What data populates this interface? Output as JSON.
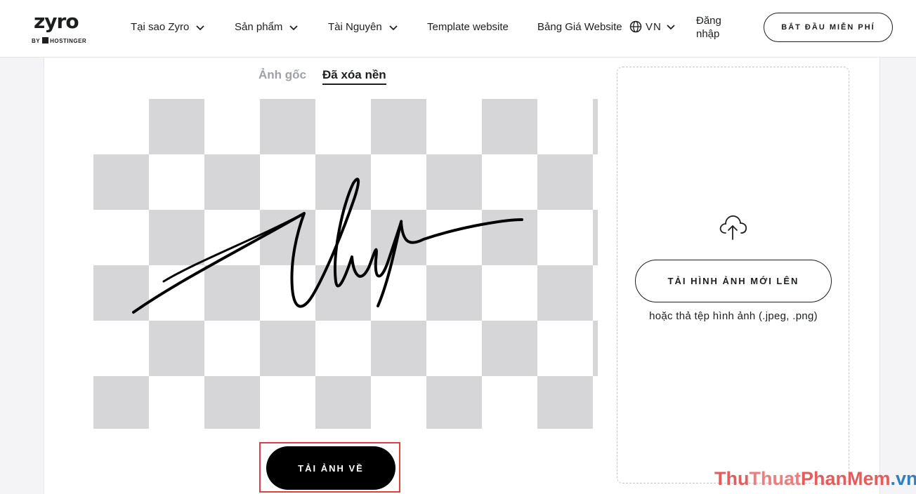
{
  "header": {
    "logo_word": "zyro",
    "logo_by": "BY",
    "logo_brand": "HOSTINGER",
    "nav": [
      {
        "label": "Tại sao Zyro"
      },
      {
        "label": "Sản phẩm"
      },
      {
        "label": "Tài Nguyên"
      },
      {
        "label": "Template website"
      },
      {
        "label": "Bảng Giá Website"
      }
    ],
    "language": "VN",
    "login": "Đăng nhập",
    "start_button": "BẮT ĐẦU MIỄN PHÍ"
  },
  "tabs": {
    "original": "Ảnh gốc",
    "removed": "Đã xóa nền",
    "active": "removed"
  },
  "editor": {
    "download_button": "TẢI ẢNH VỀ"
  },
  "upload": {
    "icon": "cloud-upload-icon",
    "button": "TẢI HÌNH ẢNH MỚI LÊN",
    "hint": "hoặc thả tệp hình ảnh (.jpeg, .png)"
  },
  "watermark": {
    "part1": "Thu",
    "part2": "Thuat",
    "part3": "PhanMem",
    "part4": ".vn"
  },
  "colors": {
    "highlight": "#e0413e",
    "primary": "#000000",
    "checker": "#d6d6d8"
  }
}
